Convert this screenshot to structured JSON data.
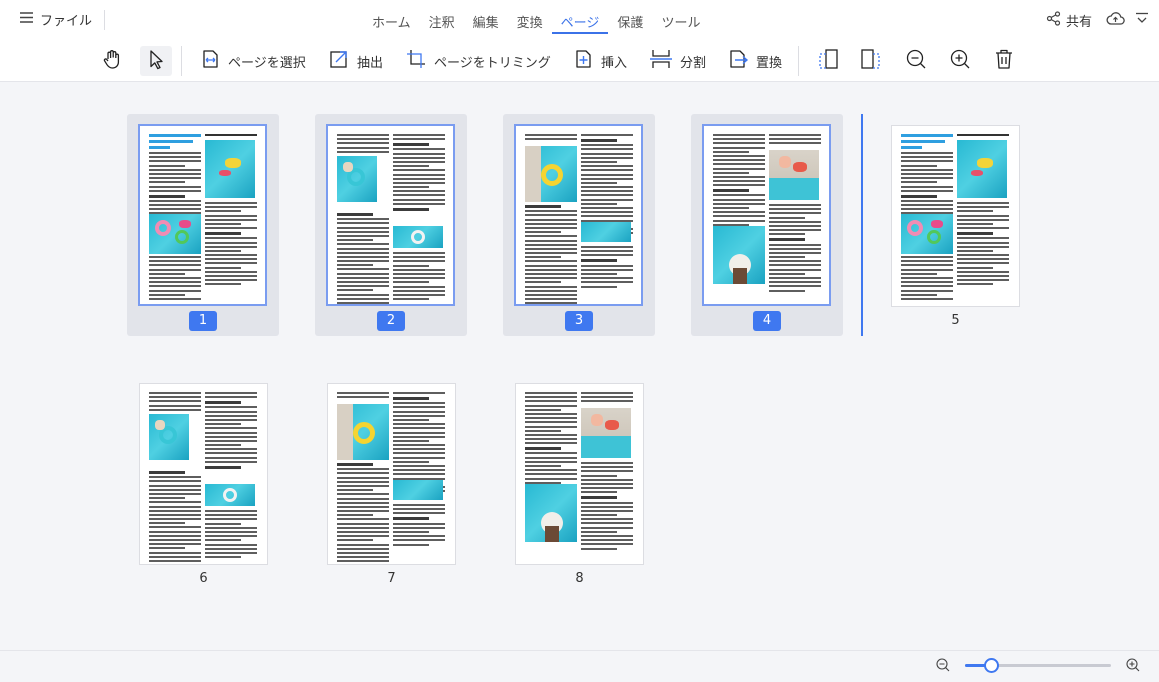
{
  "app": {
    "file_menu_label": "ファイル",
    "share_label": "共有"
  },
  "tabs": [
    {
      "label": "ホーム",
      "active": false
    },
    {
      "label": "注釈",
      "active": false
    },
    {
      "label": "編集",
      "active": false
    },
    {
      "label": "変換",
      "active": false
    },
    {
      "label": "ページ",
      "active": true
    },
    {
      "label": "保護",
      "active": false
    },
    {
      "label": "ツール",
      "active": false
    }
  ],
  "toolbar": {
    "hand_tool": {
      "icon": "hand-icon"
    },
    "select_tool": {
      "icon": "cursor-arrow-icon",
      "active": true
    },
    "select_pages": {
      "label": "ページを選択",
      "icon": "select-pages-icon"
    },
    "extract": {
      "label": "抽出",
      "icon": "extract-icon"
    },
    "trim_pages": {
      "label": "ページをトリミング",
      "icon": "crop-icon"
    },
    "insert": {
      "label": "挿入",
      "icon": "insert-icon"
    },
    "split": {
      "label": "分割",
      "icon": "split-icon"
    },
    "replace": {
      "label": "置換",
      "icon": "replace-icon"
    },
    "extra_icons": [
      "rotate-left-icon",
      "rotate-right-icon",
      "zoom-out-icon",
      "zoom-in-icon",
      "delete-icon"
    ]
  },
  "pages": [
    {
      "number": "1",
      "selected": true
    },
    {
      "number": "2",
      "selected": true
    },
    {
      "number": "3",
      "selected": true
    },
    {
      "number": "4",
      "selected": true
    },
    {
      "number": "5",
      "selected": false
    },
    {
      "number": "6",
      "selected": false
    },
    {
      "number": "7",
      "selected": false
    },
    {
      "number": "8",
      "selected": false
    }
  ],
  "page_text": {
    "cover_title": "The Joy of Summer Swimming: Diving into the Pool"
  },
  "zoom": {
    "level_fraction": 0.18
  },
  "colors": {
    "accent": "#3f78f0",
    "selected_bg": "#e2e4ea",
    "pool": "#2ab6d0"
  }
}
